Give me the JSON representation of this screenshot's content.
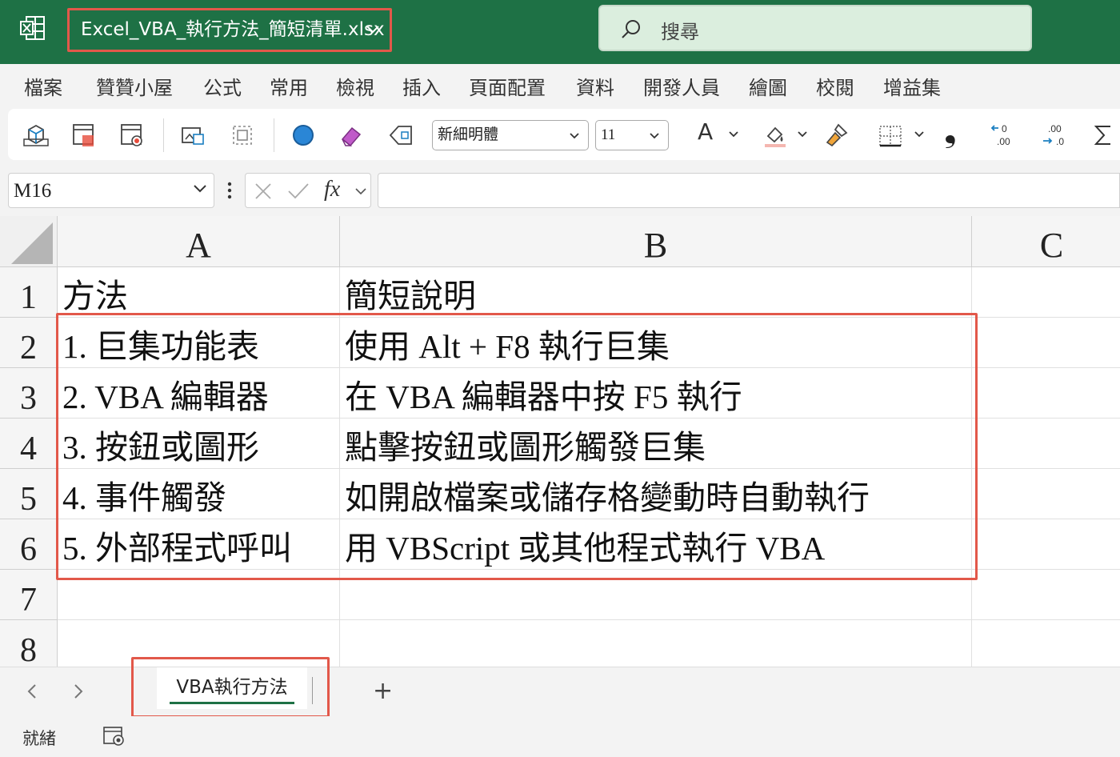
{
  "titlebar": {
    "file_name": "Excel_VBA_執行方法_簡短清單.xlsx",
    "search_placeholder": "搜尋"
  },
  "menu": [
    "檔案",
    "贊贊小屋",
    "公式",
    "常用",
    "檢視",
    "插入",
    "頁面配置",
    "資料",
    "開發人員",
    "繪圖",
    "校閱",
    "增益集"
  ],
  "ribbon": {
    "font_name": "新細明體",
    "font_size": "11",
    "font_color_label": "A",
    "comma_label": "❟"
  },
  "formula_bar": {
    "name_box": "M16",
    "fx_label": "fx",
    "formula": ""
  },
  "grid": {
    "columns": [
      "A",
      "B",
      "C"
    ],
    "rows": [
      {
        "num": "1",
        "a": "方法",
        "b": "簡短說明",
        "c": ""
      },
      {
        "num": "2",
        "a": "1. 巨集功能表",
        "b": "使用 Alt + F8 執行巨集",
        "c": ""
      },
      {
        "num": "3",
        "a": "2. VBA 編輯器",
        "b": "在 VBA 編輯器中按 F5 執行",
        "c": ""
      },
      {
        "num": "4",
        "a": "3. 按鈕或圖形",
        "b": "點擊按鈕或圖形觸發巨集",
        "c": ""
      },
      {
        "num": "5",
        "a": "4. 事件觸發",
        "b": "如開啟檔案或儲存格變動時自動執行",
        "c": ""
      },
      {
        "num": "6",
        "a": "5. 外部程式呼叫",
        "b": "用 VBScript 或其他程式執行 VBA",
        "c": ""
      },
      {
        "num": "7",
        "a": "",
        "b": "",
        "c": ""
      },
      {
        "num": "8",
        "a": "",
        "b": "",
        "c": ""
      }
    ]
  },
  "sheets": {
    "active": "VBA執行方法",
    "add_label": "+"
  },
  "status": {
    "text": "就緒"
  },
  "colors": {
    "title_green": "#1e7145",
    "highlight_red": "#e2584a"
  }
}
